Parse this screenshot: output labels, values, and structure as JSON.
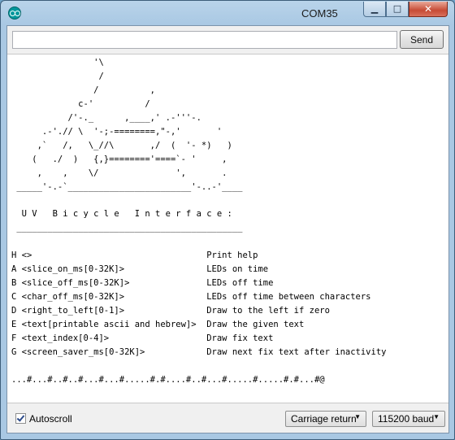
{
  "window": {
    "title": "COM35",
    "minimize_glyph": "▁",
    "maximize_glyph": "□",
    "close_glyph": "✕"
  },
  "send": {
    "input_value": "",
    "button_label": "Send"
  },
  "serial_monitor": {
    "lines": [
      "                '\\",
      "                 /",
      "                /          ,",
      "             c-'          /",
      "           /'-._      ,____,' .-'''-.",
      "      .-'.// \\  '-;-========,\"-,'       '",
      "     ,`   /,   \\_//\\       ,/  (  '- *)   )",
      "    (   ./  )   {,}========'====`- '     ,",
      "     ,    ,    \\/               ',       .",
      " _____'-.-`________________________'-..-'____",
      "",
      "  U V   B i c y c l e   I n t e r f a c e :",
      " ____________________________________________",
      "",
      "H <>                                  Print help",
      "A <slice_on_ms[0-32K]>                LEDs on time",
      "B <slice_off_ms[0-32K]>               LEDs off time",
      "C <char_off_ms[0-32K]>                LEDs off time between characters",
      "D <right_to_left[0-1]>                Draw to the left if zero",
      "E <text[printable ascii and hebrew]>  Draw the given text",
      "F <text_index[0-4]>                   Draw fix text",
      "G <screen_saver_ms[0-32K]>            Draw next fix text after inactivity",
      "",
      "...#...#..#..#...#...#.....#.#....#..#...#.....#.....#.#...#@"
    ]
  },
  "footer": {
    "autoscroll_label": "Autoscroll",
    "autoscroll_checked": true,
    "line_ending": "Carriage return",
    "baud_rate": "115200 baud",
    "caret_glyph": "▼"
  }
}
